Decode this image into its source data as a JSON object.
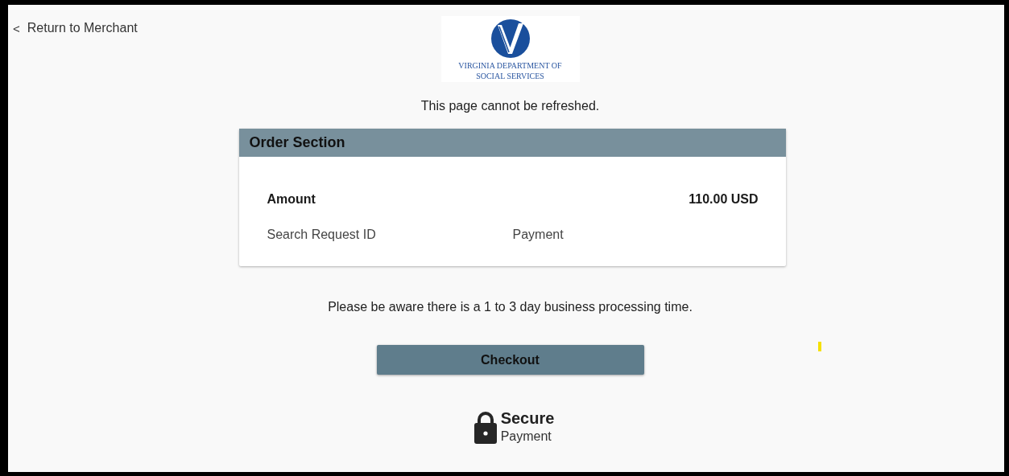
{
  "back_link": {
    "icon": "<",
    "label": "Return to Merchant"
  },
  "logo": {
    "line_1": "VIRGINIA DEPARTMENT OF",
    "line_2": "SOCIAL SERVICES"
  },
  "notice": "This page cannot be refreshed.",
  "order_section": {
    "title": "Order Section",
    "rows": [
      {
        "kind": "total",
        "label": "Amount",
        "value": "110.00 USD"
      },
      {
        "kind": "detail",
        "label": "Search Request ID",
        "value": "Payment"
      }
    ]
  },
  "processing_note": "Please be aware there is a 1 to 3 day business processing time.",
  "checkout_button": "Checkout",
  "secure_badge": {
    "title": "Secure",
    "subtitle": "Payment"
  }
}
